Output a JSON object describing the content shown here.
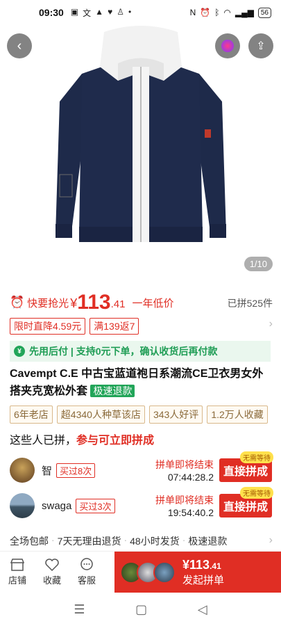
{
  "status": {
    "time": "09:30",
    "battery": "56"
  },
  "hero": {
    "counter": "1/10"
  },
  "price": {
    "label": "快要抢光",
    "yen": "¥",
    "int": "113",
    "dec": ".41",
    "tag": "一年低价",
    "sold": "已拼525件"
  },
  "coupons": [
    "限时直降4.59元",
    "满139返7"
  ],
  "pay_after": "先用后付 | 支持0元下单，确认收货后再付款",
  "title": {
    "text": "Cavempt C.E 中古宝蓝道袍日系潮流CE卫衣男女外搭夹克宽松外套",
    "badge": "极速退款"
  },
  "tags": [
    "6年老店",
    "超4340人种草该店",
    "343人好评",
    "1.2万人收藏"
  ],
  "group": {
    "head_a": "这些人已拼，",
    "head_b": "参与可立即拼成",
    "rows": [
      {
        "name": "智",
        "bought": "买过8次",
        "ending": "拼单即将结束",
        "time": "07:44:28.2",
        "button": "直接拼成",
        "nowait": "无需等待"
      },
      {
        "name": "swaga",
        "bought": "买过3次",
        "ending": "拼单即将结束",
        "time": "19:54:40.2",
        "button": "直接拼成",
        "nowait": "无需等待"
      }
    ]
  },
  "services": [
    "全场包邮",
    "7天无理由退货",
    "48小时发货",
    "极速退款"
  ],
  "bottom": {
    "store": "店铺",
    "fav": "收藏",
    "service": "客服",
    "price_int": "¥113",
    "price_dec": ".41",
    "action": "发起拼单"
  },
  "colors": {
    "accent": "#e02e24",
    "green": "#22a559",
    "navy": "#1e2a4a"
  }
}
